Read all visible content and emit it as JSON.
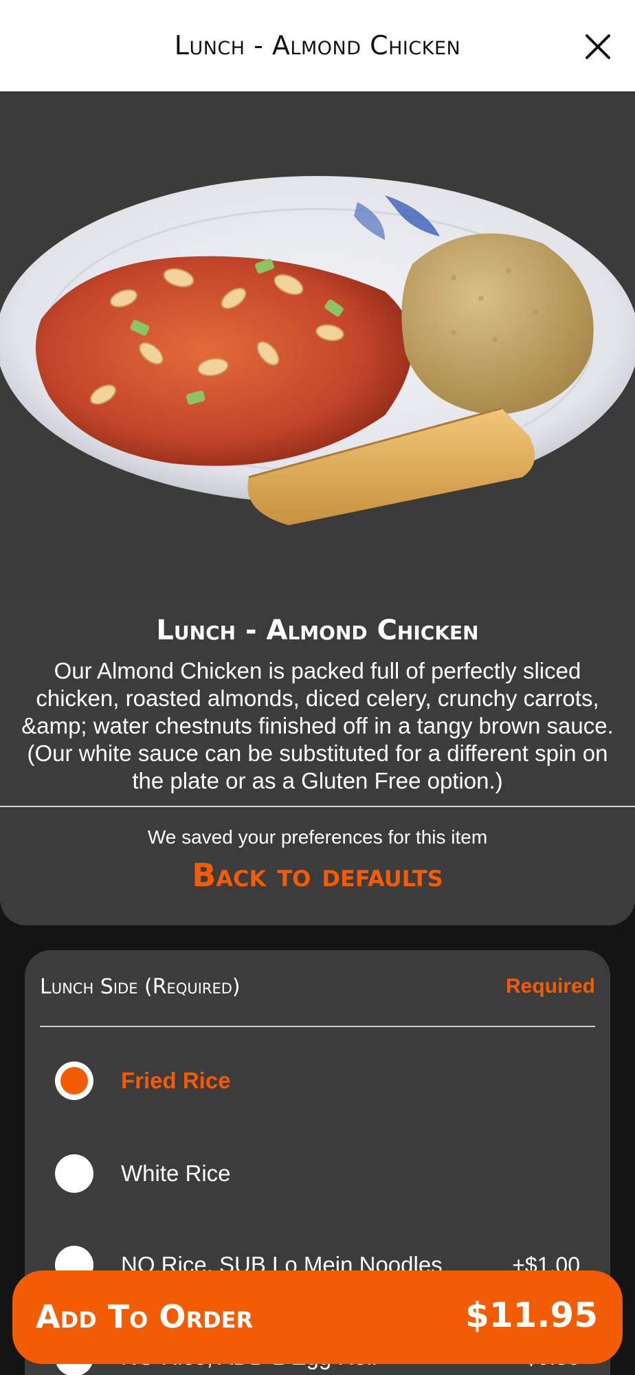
{
  "header": {
    "title": "Lunch - Almond Chicken",
    "close_icon": "close-icon"
  },
  "item": {
    "image_icon": "dish-photo-almond-chicken",
    "title": "Lunch - Almond Chicken",
    "description": "Our Almond Chicken is packed full of perfectly sliced chicken, roasted almonds, diced celery, crunchy carrots, &amp; water chestnuts finished off in a tangy brown sauce. (Our white sauce can be substituted for a different spin on the plate or as a Gluten Free option.)"
  },
  "preferences": {
    "saved_note": "We saved your preferences for this item",
    "back_to_defaults": "Back to defaults"
  },
  "option_group": {
    "title": "Lunch Side (Required)",
    "required_label": "Required",
    "options": [
      {
        "label": "Fried Rice",
        "price": "",
        "selected": true
      },
      {
        "label": "White Rice",
        "price": "",
        "selected": false
      },
      {
        "label": "NO Rice, SUB Lo Mein Noodles",
        "price": "+$1.00",
        "selected": false
      },
      {
        "label": "NO Rice, ADD 1 Egg Roll",
        "price": "+$0.50",
        "selected": false
      }
    ]
  },
  "footer": {
    "add_label": "Add To Order",
    "price": "$11.95"
  },
  "colors": {
    "accent": "#f25c05",
    "panel": "#3c3c3c",
    "background": "#141414"
  }
}
